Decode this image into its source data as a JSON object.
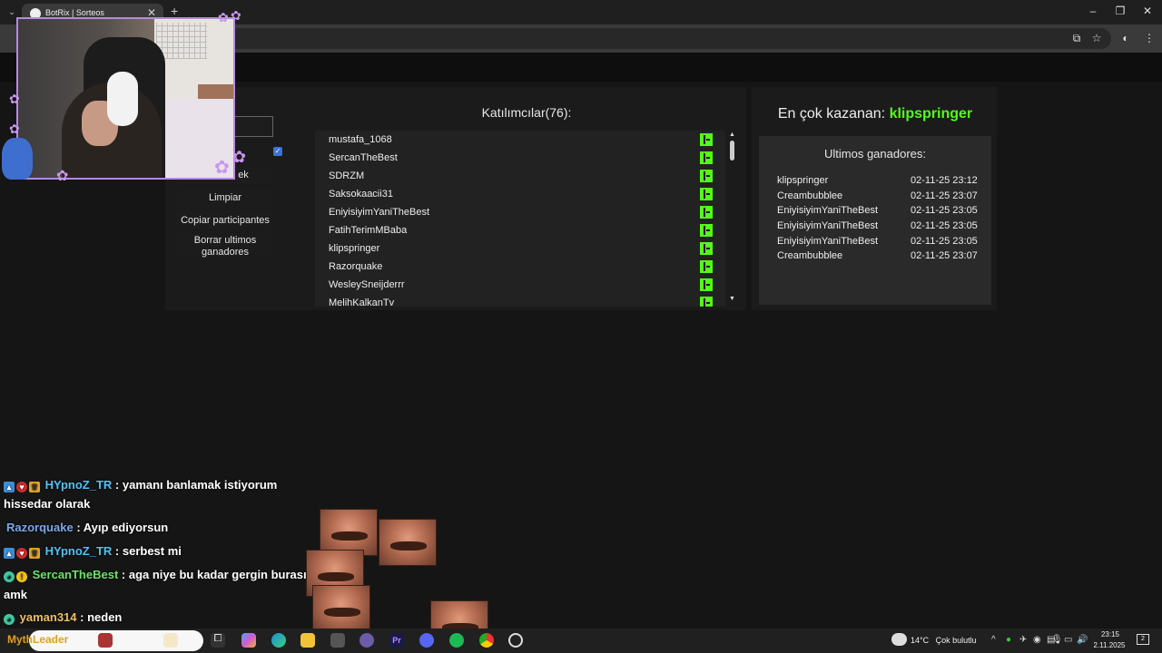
{
  "browser": {
    "tab_title": "BotRix | Sorteos",
    "new_tab_symbol": "+",
    "tab_close_symbol": "✕"
  },
  "controls": {
    "hidden_button_label": "ek",
    "clear_label": "Limpiar",
    "copy_label": "Copiar participantes",
    "delete_label": "Borrar ultimos ganadores",
    "checkbox_checked": true
  },
  "participants": {
    "title": "Katılımcılar(76):",
    "items": [
      {
        "name": "mustafa_1068"
      },
      {
        "name": "SercanTheBest"
      },
      {
        "name": "SDRZM"
      },
      {
        "name": "Saksokaacii31"
      },
      {
        "name": "EniyisiyimYaniTheBest"
      },
      {
        "name": "FatihTerimMBaba"
      },
      {
        "name": "klipspringer"
      },
      {
        "name": "Razorquake"
      },
      {
        "name": "WesleySneijderrr"
      },
      {
        "name": "MelihKalkanTv"
      }
    ],
    "platform_icon": "kick-icon",
    "platform_color": "#53fc18"
  },
  "winners": {
    "top_label": "En çok kazanan:",
    "top_name": "klipspringer",
    "list_title": "Ultimos ganadores:",
    "items": [
      {
        "name": "klipspringer",
        "date": "02-11-25 23:12"
      },
      {
        "name": "Creambubblee",
        "date": "02-11-25 23:07"
      },
      {
        "name": "EniyisiyimYaniTheBest",
        "date": "02-11-25 23:05"
      },
      {
        "name": "EniyisiyimYaniTheBest",
        "date": "02-11-25 23:05"
      },
      {
        "name": "EniyisiyimYaniTheBest",
        "date": "02-11-25 23:05"
      },
      {
        "name": "Creambubblee",
        "date": "02-11-25 23:07"
      }
    ]
  },
  "chat": {
    "messages": [
      {
        "user": "HYpnoZ_TR",
        "color": "#4fc3f7",
        "text": "yamanı banlamak istiyorum"
      },
      {
        "user": "",
        "color": "#ffffff",
        "text": "hissedar olarak"
      },
      {
        "user": "Razorquake",
        "color": "#7aa7e6",
        "text": "Ayıp ediyorsun"
      },
      {
        "user": "HYpnoZ_TR",
        "color": "#4fc3f7",
        "text": "serbest mi"
      },
      {
        "user": "SercanTheBest",
        "color": "#6be36b",
        "text": "aga niye bu kadar gergin burası"
      },
      {
        "user": "",
        "color": "#ffffff",
        "text": "amk"
      },
      {
        "user": "yaman314",
        "color": "#f0c060",
        "text": "neden"
      }
    ],
    "separator": " : "
  },
  "taskbar": {
    "search_text": "MythLeader",
    "weather_temp": "14°C",
    "weather_desc": "Çok bulutlu",
    "time": "23:15",
    "date": "2.11.2025",
    "notification_count": "2"
  }
}
